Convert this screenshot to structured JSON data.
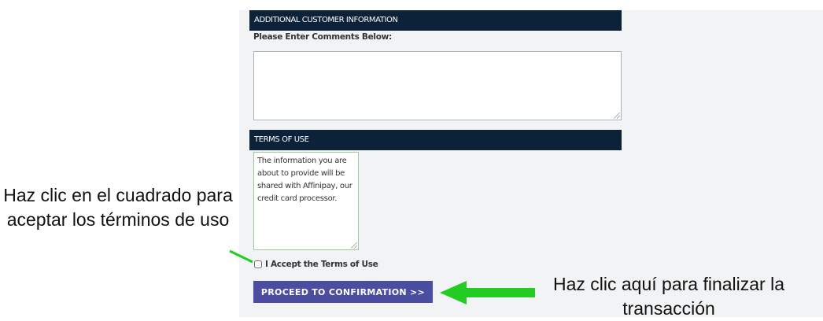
{
  "form": {
    "additional_header": "ADDITIONAL CUSTOMER INFORMATION",
    "comments_label": "Please Enter Comments Below:",
    "comments_value": "",
    "terms_header": "TERMS OF USE",
    "terms_text": "The information you are about to provide will be shared with Affinipay, our credit card processor.",
    "accept_label": "I Accept the Terms of Use",
    "accept_checked": false,
    "proceed_label": "PROCEED TO CONFIRMATION >>"
  },
  "annotations": {
    "left_note": "Haz clic en el cuadrado para aceptar los términos de uso",
    "right_note": "Haz clic aquí para finalizar la transacción"
  },
  "colors": {
    "header_bar": "#0c2238",
    "button": "#4a4da0",
    "arrow": "#22cc22",
    "panel_bg": "#f2f3f5"
  },
  "icons": {
    "resize_grip": "resize-grip-icon",
    "arrow": "arrow-left-icon"
  }
}
